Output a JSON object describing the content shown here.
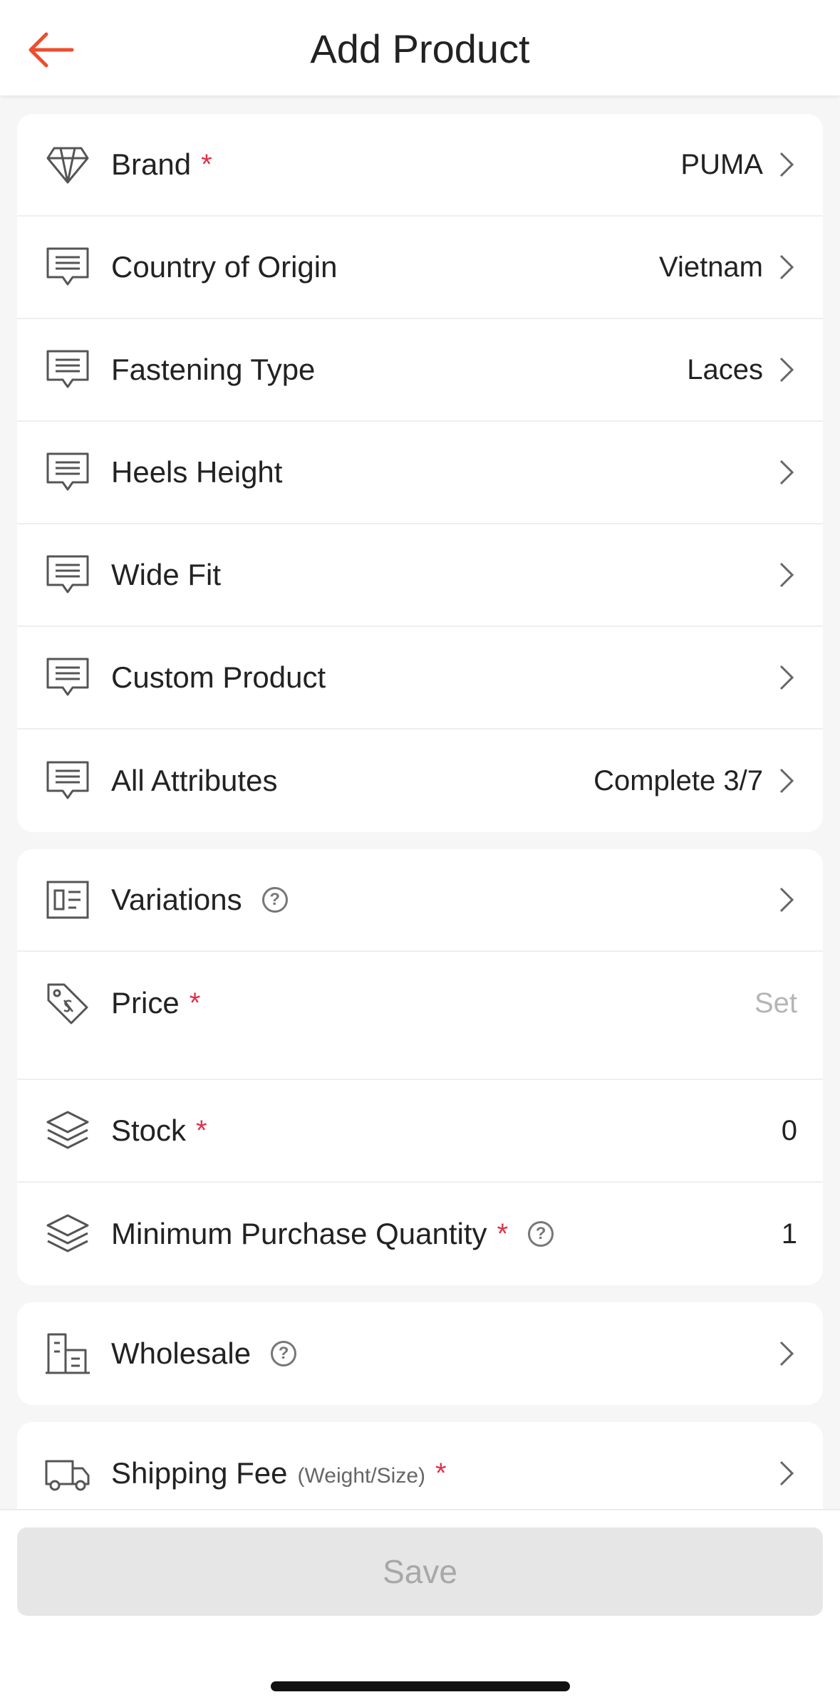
{
  "header": {
    "title": "Add Product",
    "back_icon": "arrow-left-icon",
    "accent": "#ee4d2d"
  },
  "attributes": [
    {
      "label": "Brand",
      "required": "*",
      "value": "PUMA",
      "icon": "diamond-icon"
    },
    {
      "label": "Country of Origin",
      "value": "Vietnam",
      "icon": "message-list-icon"
    },
    {
      "label": "Fastening Type",
      "value": "Laces",
      "icon": "message-list-icon"
    },
    {
      "label": "Heels Height",
      "value": "",
      "icon": "message-list-icon"
    },
    {
      "label": "Wide Fit",
      "value": "",
      "icon": "message-list-icon"
    },
    {
      "label": "Custom Product",
      "value": "",
      "icon": "message-list-icon"
    },
    {
      "label": "All Attributes",
      "value": "Complete 3/7",
      "icon": "message-list-icon"
    }
  ],
  "sales": {
    "variations": {
      "label": "Variations",
      "help": "?"
    },
    "price": {
      "label": "Price",
      "required": "*",
      "placeholder": "Set"
    },
    "stock": {
      "label": "Stock",
      "required": "*",
      "value": "0"
    },
    "min_qty": {
      "label": "Minimum Purchase Quantity",
      "required": "*",
      "help": "?",
      "value": "1"
    }
  },
  "wholesale": {
    "label": "Wholesale",
    "help": "?"
  },
  "shipping": {
    "label": "Shipping Fee",
    "sub": "(Weight/Size)",
    "required": "*"
  },
  "footer": {
    "save_label": "Save"
  },
  "colors": {
    "required": "#e0314b",
    "placeholder": "#b5b5b5",
    "disabled_button": "#e6e6e6"
  }
}
